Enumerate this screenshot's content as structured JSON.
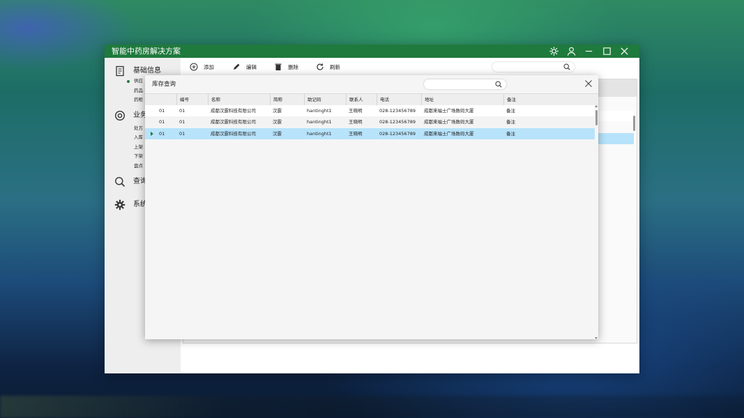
{
  "app": {
    "title": "智能中药房解决方案",
    "title_color": "#1f7a3d"
  },
  "sidebar": {
    "sections": [
      {
        "label": "基础信息",
        "icon": "document-icon"
      },
      {
        "label": "业务",
        "icon": "compass-icon"
      },
      {
        "label": "查询",
        "icon": "search-icon"
      },
      {
        "label": "系统",
        "icon": "gear-icon"
      }
    ],
    "basic_items": [
      "供应",
      "药品",
      "药柜"
    ],
    "business_items": [
      "处方",
      "入库",
      "上架",
      "下架",
      "盘点"
    ]
  },
  "toolbar": {
    "add_label": "添加",
    "edit_label": "编辑",
    "delete_label": "删除",
    "refresh_label": "刷新"
  },
  "dialog": {
    "title": "库存查询",
    "search_placeholder": "",
    "columns": [
      "编号",
      "名称",
      "简称",
      "助记码",
      "联系人",
      "电话",
      "地址",
      "备注"
    ],
    "rows": [
      {
        "c0": "01",
        "c1": "01",
        "name": "成都汉霆科技有限公司",
        "short": "汉霆",
        "code": "hantinght1",
        "contact": "王晓明",
        "phone": "028-123456789",
        "addr": "成都来福士广场数码大厦",
        "note": "备注"
      },
      {
        "c0": "01",
        "c1": "01",
        "name": "成都汉霆科技有限公司",
        "short": "汉霆",
        "code": "hantinght1",
        "contact": "王晓明",
        "phone": "028-123456789",
        "addr": "成都来福士广场数码大厦",
        "note": "备注"
      },
      {
        "c0": "01",
        "c1": "01",
        "name": "成都汉霆科技有限公司",
        "short": "汉霆",
        "code": "hantinght1",
        "contact": "王晓明",
        "phone": "028-123456789",
        "addr": "成都来福士广场数码大厦",
        "note": "备注"
      }
    ],
    "selected_row": 3,
    "selection_color": "#b7e3fb"
  },
  "window_controls": [
    "settings-icon",
    "user-icon",
    "minimize-icon",
    "maximize-icon",
    "close-icon"
  ]
}
